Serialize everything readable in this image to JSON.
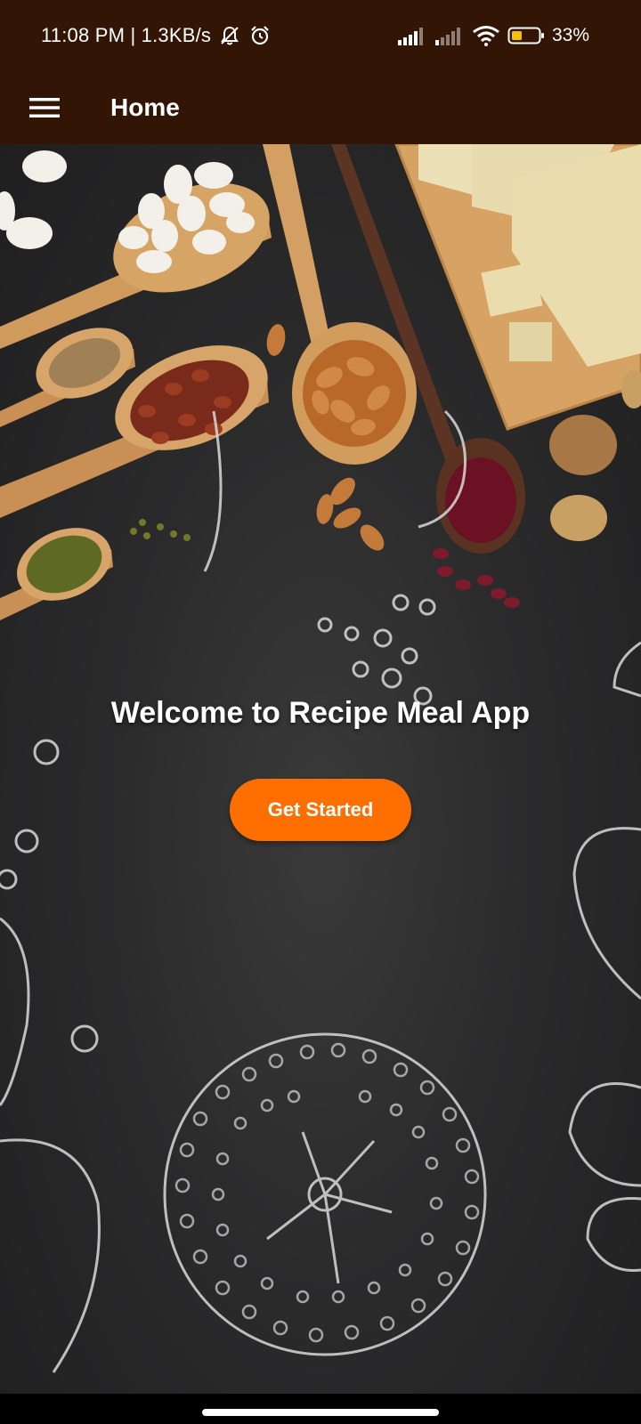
{
  "status_bar": {
    "time_speed": "11:08 PM | 1.3KB/s",
    "battery": "33%",
    "icons": [
      "muted-bell-icon",
      "alarm-icon",
      "signal-icon",
      "signal-icon",
      "wifi-icon",
      "battery-icon"
    ]
  },
  "app_bar": {
    "title": "Home",
    "menu_icon": "hamburger-menu-icon",
    "background": "#321504"
  },
  "main": {
    "welcome_text": "Welcome to Recipe Meal App",
    "cta_label": "Get Started",
    "cta_color": "#ff6f00"
  }
}
